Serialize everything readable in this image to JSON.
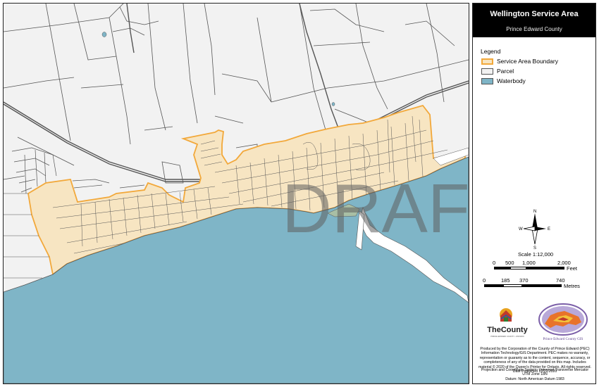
{
  "title": "Wellington Service Area",
  "subtitle": "Prince Edward County",
  "watermark": "DRAFT",
  "legend": {
    "heading": "Legend",
    "items": [
      {
        "label": "Service Area Boundary",
        "fill": "#f7e5c2",
        "stroke": "#f2a83a"
      },
      {
        "label": "Parcel",
        "fill": "#f2f2f2",
        "stroke": "#555555"
      },
      {
        "label": "Waterbody",
        "fill": "#7fb5c7",
        "stroke": "#555555"
      }
    ]
  },
  "north_arrow": {
    "n": "N",
    "s": "S",
    "e": "E",
    "w": "W"
  },
  "scale": {
    "ratio": "Scale 1:12,000",
    "feet_ticks": [
      "0",
      "500",
      "1,000",
      "2,000"
    ],
    "feet_unit": "Feet",
    "metre_ticks": [
      "0",
      "185",
      "370",
      "740"
    ],
    "metre_unit": "Metres"
  },
  "logos": {
    "county_name": "TheCounty",
    "county_tagline": "PRINCE EDWARD COUNTY • ONTARIO",
    "gis_name": "Prince Edward County GIS"
  },
  "credits": {
    "disclaimer": "Produced by the Corporation of the County of Prince Edward (PEC) Information Technology/GIS Department. PEC makes no warranty, representation or guaranty as to the content, sequence, accuracy, or completeness of any of the data provided on this map. Includes material © 2020 of the Queen's Printer for Ontario. All rights reserved. Date Published 12/22/2020",
    "projection": "Projection and Coordinate System: Universal Transverse Mercator UTM Zone 18N",
    "datum": "Datum: North American Datum 1983"
  },
  "colors": {
    "water": "#7fb5c7",
    "land": "#f2f2f2",
    "service_fill": "#f7e5c2",
    "service_stroke": "#f2a83a",
    "parcel_line": "#555555",
    "title_bg": "#000000"
  }
}
